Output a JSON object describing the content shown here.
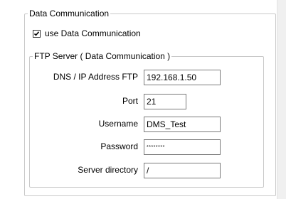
{
  "data_communication": {
    "group_title": "Data Communication",
    "use_checkbox": {
      "label": "use Data Communication",
      "checked": true
    }
  },
  "ftp_server": {
    "group_title": "FTP Server ( Data Communication )",
    "fields": {
      "address": {
        "label": "DNS / IP Address FTP",
        "value": "192.168.1.50"
      },
      "port": {
        "label": "Port",
        "value": "21"
      },
      "username": {
        "label": "Username",
        "value": "DMS_Test"
      },
      "password": {
        "label": "Password",
        "value": "********"
      },
      "directory": {
        "label": "Server directory",
        "value": "/"
      }
    }
  }
}
